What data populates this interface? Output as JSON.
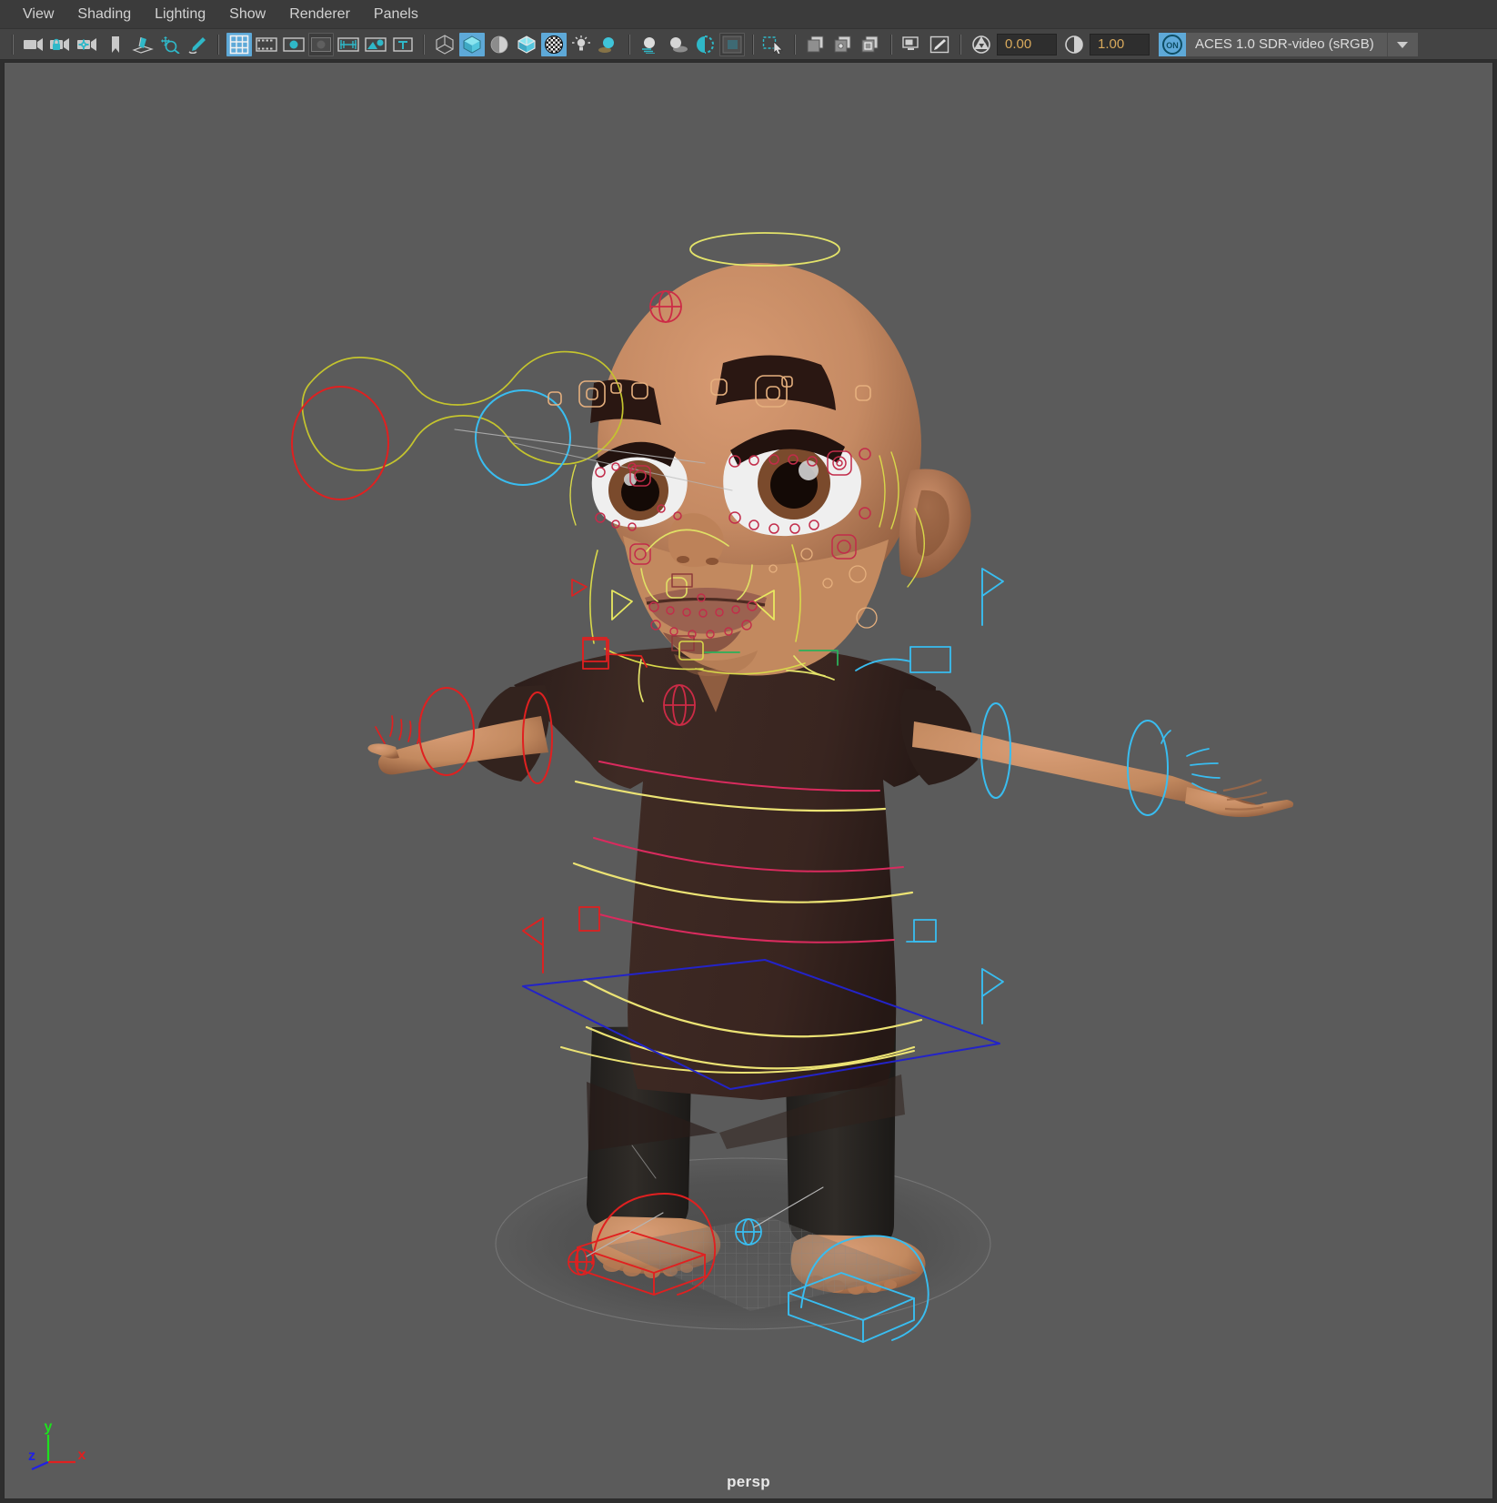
{
  "window": {
    "title": "persp viewport",
    "bg_color": "#5b5b5b",
    "menubar_color": "#3b3b3b",
    "toolbar_color": "#444444",
    "accent_color": "#5ea9d8"
  },
  "menubar": {
    "items": [
      {
        "label": "View"
      },
      {
        "label": "Shading"
      },
      {
        "label": "Lighting"
      },
      {
        "label": "Show"
      },
      {
        "label": "Renderer"
      },
      {
        "label": "Panels"
      }
    ]
  },
  "toolbar": {
    "groups": [
      {
        "name": "camera-group",
        "buttons": [
          {
            "icon": "select-camera-icon",
            "label": "Select camera",
            "state": "normal"
          },
          {
            "icon": "lock-camera-icon",
            "label": "Lock camera",
            "state": "normal"
          },
          {
            "icon": "camera-attributes-icon",
            "label": "Camera attributes",
            "state": "normal"
          },
          {
            "icon": "bookmark-icon",
            "label": "Bookmarks",
            "state": "normal"
          },
          {
            "icon": "image-plane-icon",
            "label": "Image plane",
            "state": "normal"
          },
          {
            "icon": "two-dimensional-pan-zoom-icon",
            "label": "2D Pan/Zoom",
            "state": "normal"
          },
          {
            "icon": "grease-pencil-icon",
            "label": "Grease pencil",
            "state": "normal"
          }
        ]
      },
      {
        "name": "gate-group",
        "buttons": [
          {
            "icon": "grid-icon",
            "label": "Grid",
            "state": "active"
          },
          {
            "icon": "film-gate-icon",
            "label": "Film gate",
            "state": "normal"
          },
          {
            "icon": "resolution-gate-icon",
            "label": "Resolution gate",
            "state": "normal"
          },
          {
            "icon": "gate-mask-icon",
            "label": "Gate mask",
            "state": "sunken"
          },
          {
            "icon": "field-chart-icon",
            "label": "Field chart",
            "state": "normal"
          },
          {
            "icon": "safe-action-icon",
            "label": "Safe action",
            "state": "normal"
          },
          {
            "icon": "safe-title-icon",
            "label": "Safe title",
            "state": "normal"
          }
        ]
      },
      {
        "name": "shading-group",
        "buttons": [
          {
            "icon": "wireframe-icon",
            "label": "Wireframe",
            "state": "normal"
          },
          {
            "icon": "smooth-shade-all-icon",
            "label": "Smooth shade all",
            "state": "active"
          },
          {
            "icon": "smooth-shade-flat-icon",
            "label": "Smooth shade flat",
            "state": "normal"
          },
          {
            "icon": "shaded-wireframe-icon",
            "label": "Shaded and wireframe",
            "state": "normal"
          },
          {
            "icon": "textured-icon",
            "label": "Textured",
            "state": "active"
          },
          {
            "icon": "use-lights-icon",
            "label": "Use all lights",
            "state": "normal"
          },
          {
            "icon": "shadows-icon",
            "label": "Shadows",
            "state": "normal"
          }
        ]
      },
      {
        "name": "quality-group",
        "buttons": [
          {
            "icon": "motion-blur-icon",
            "label": "Motion blur",
            "state": "normal"
          },
          {
            "icon": "ambient-occlusion-icon",
            "label": "Screen space ambient occlusion",
            "state": "normal"
          },
          {
            "icon": "anti-alias-icon",
            "label": "Multisample anti-aliasing",
            "state": "normal"
          },
          {
            "icon": "depth-of-field-icon",
            "label": "Depth of field",
            "state": "sunken"
          }
        ]
      },
      {
        "name": "isolate-group",
        "buttons": [
          {
            "icon": "isolate-select-icon",
            "label": "Isolate select",
            "state": "normal"
          }
        ]
      },
      {
        "name": "xray-group",
        "buttons": [
          {
            "icon": "xray-icon",
            "label": "X-Ray",
            "state": "normal"
          },
          {
            "icon": "xray-joints-icon",
            "label": "X-Ray joints",
            "state": "normal"
          },
          {
            "icon": "xray-active-components-icon",
            "label": "X-Ray active components",
            "state": "normal"
          }
        ]
      },
      {
        "name": "display-group",
        "buttons": [
          {
            "icon": "exposure-display-icon",
            "label": "Display render region",
            "state": "normal"
          },
          {
            "icon": "color-picker-icon",
            "label": "Color picker",
            "state": "normal"
          }
        ]
      }
    ],
    "exposure": {
      "icon": "aperture-icon",
      "label": "Exposure",
      "value": "0.00"
    },
    "gamma": {
      "icon": "contrast-icon",
      "label": "Gamma",
      "value": "1.00"
    },
    "color_management": {
      "toggle_label": "ON",
      "toggle_enabled": true,
      "transform_name": "ACES 1.0 SDR-video (sRGB)",
      "dropdown_icon": "chevron-down-icon"
    }
  },
  "viewport": {
    "camera_label": "persp",
    "axis_gizmo": {
      "x_label": "x",
      "y_label": "y",
      "z_label": "z",
      "x_color": "#e02020",
      "y_color": "#1ee01e",
      "z_color": "#2020e6"
    },
    "scene": {
      "description": "Rigged cartoon toddler character in T-pose with facial and body animation controls visible",
      "controller_colors": {
        "left_side": "#2fb8ef",
        "right_side": "#ee2222",
        "center": "#d8d84a",
        "secondary": "#d89a5a",
        "root": "#2323c8",
        "facial": "#c22c4a"
      },
      "character": {
        "skin": "#c68a63",
        "skin_shadow": "#9a6343",
        "shirt": "#3a2823",
        "shirt_shadow": "#2a1c18",
        "pants": "#2a2724",
        "eye_white": "#efefef",
        "iris": "#7a4a2c",
        "pupil": "#140a06",
        "brow": "#2a1712",
        "lips": "#9b6250"
      },
      "ground": {
        "shadow_ellipse_color": "#4e4e4e",
        "grid_color": "#6d6d6d"
      }
    }
  }
}
